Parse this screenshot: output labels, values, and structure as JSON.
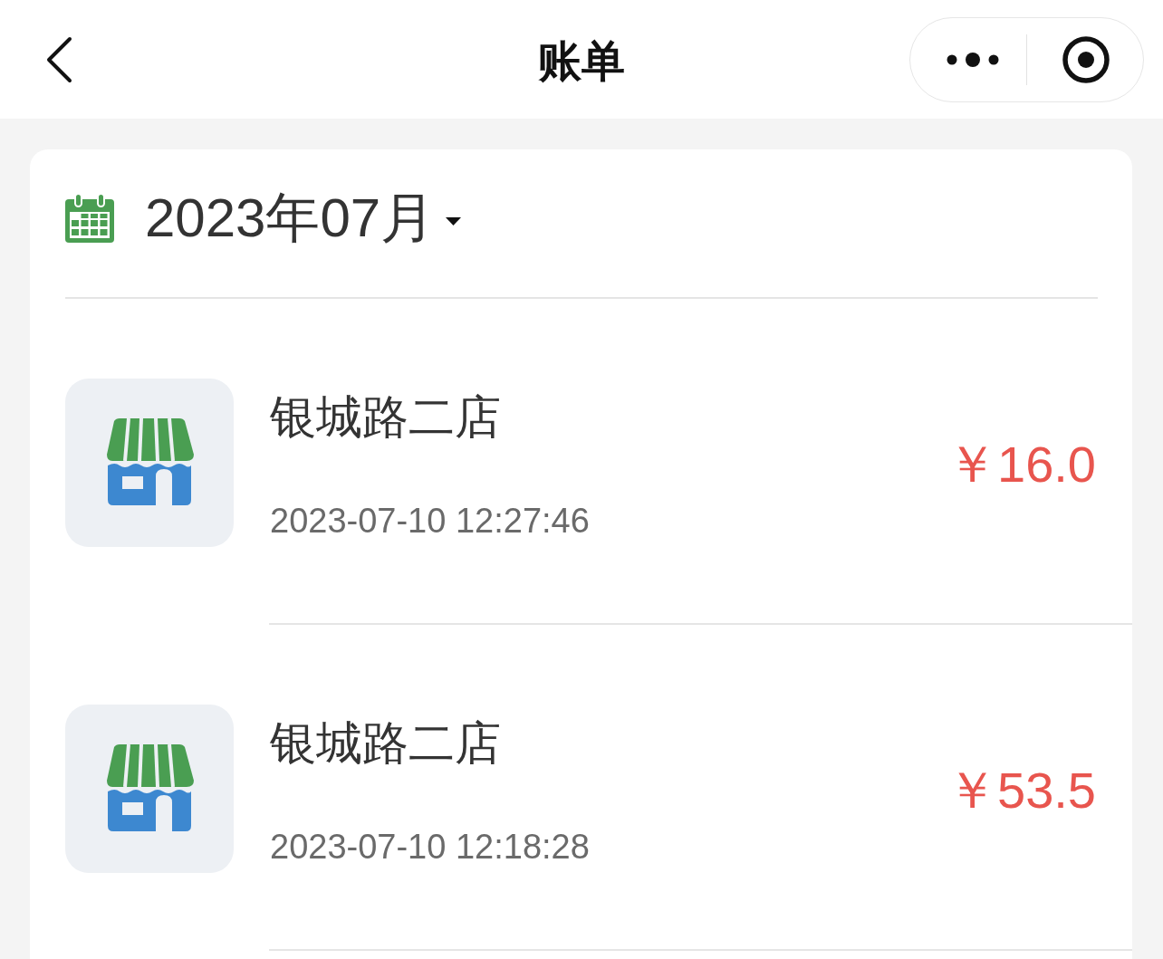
{
  "nav_bar": {
    "title": "账单"
  },
  "month_picker": {
    "label": "2023年07月"
  },
  "bills": [
    {
      "merchant": "银城路二店",
      "time": "2023-07-10 12:27:46",
      "amount": "￥16.0"
    },
    {
      "merchant": "银城路二店",
      "time": "2023-07-10 12:18:28",
      "amount": "￥53.5"
    }
  ]
}
